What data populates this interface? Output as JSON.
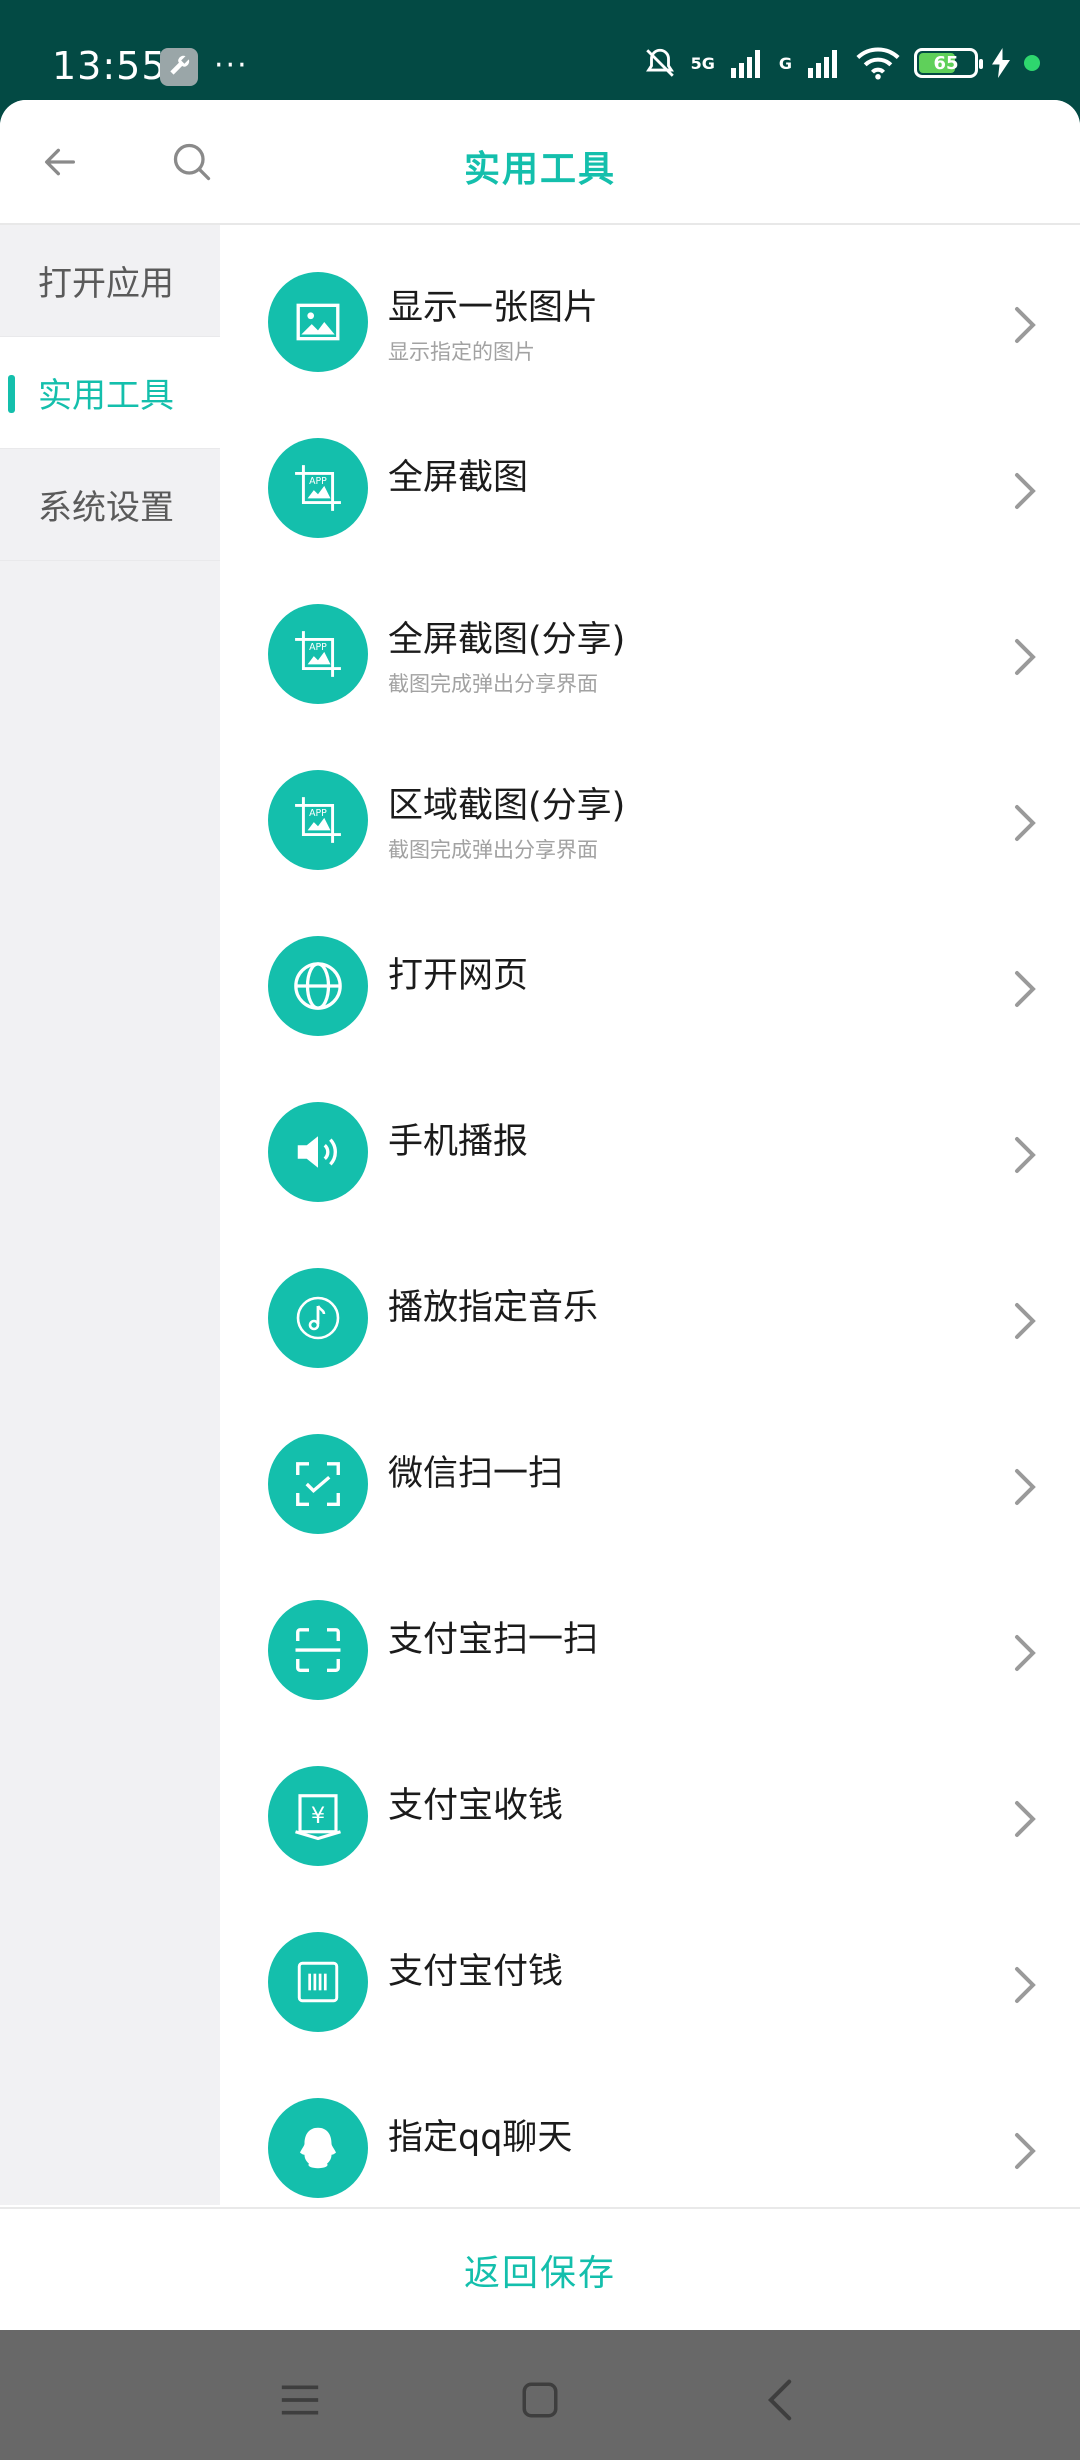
{
  "status_bar": {
    "time": "13:55",
    "dots": "···",
    "network": "5G",
    "network2": "G",
    "battery": "65"
  },
  "header": {
    "title": "实用工具"
  },
  "sidebar": {
    "items": [
      {
        "label": "打开应用"
      },
      {
        "label": "实用工具"
      },
      {
        "label": "系统设置"
      }
    ]
  },
  "list": {
    "items": [
      {
        "label": "显示一张图片",
        "sub": "显示指定的图片"
      },
      {
        "label": "全屏截图",
        "sub": ""
      },
      {
        "label": "全屏截图(分享)",
        "sub": "截图完成弹出分享界面"
      },
      {
        "label": "区域截图(分享)",
        "sub": "截图完成弹出分享界面"
      },
      {
        "label": "打开网页",
        "sub": ""
      },
      {
        "label": "手机播报",
        "sub": ""
      },
      {
        "label": "播放指定音乐",
        "sub": ""
      },
      {
        "label": "微信扫一扫",
        "sub": ""
      },
      {
        "label": "支付宝扫一扫",
        "sub": ""
      },
      {
        "label": "支付宝收钱",
        "sub": ""
      },
      {
        "label": "支付宝付钱",
        "sub": ""
      },
      {
        "label": "指定qq聊天",
        "sub": ""
      }
    ]
  },
  "footer": {
    "save_label": "返回保存"
  },
  "colors": {
    "accent": "#14bfac",
    "statusbar": "#034a44",
    "navbar": "#686868"
  }
}
